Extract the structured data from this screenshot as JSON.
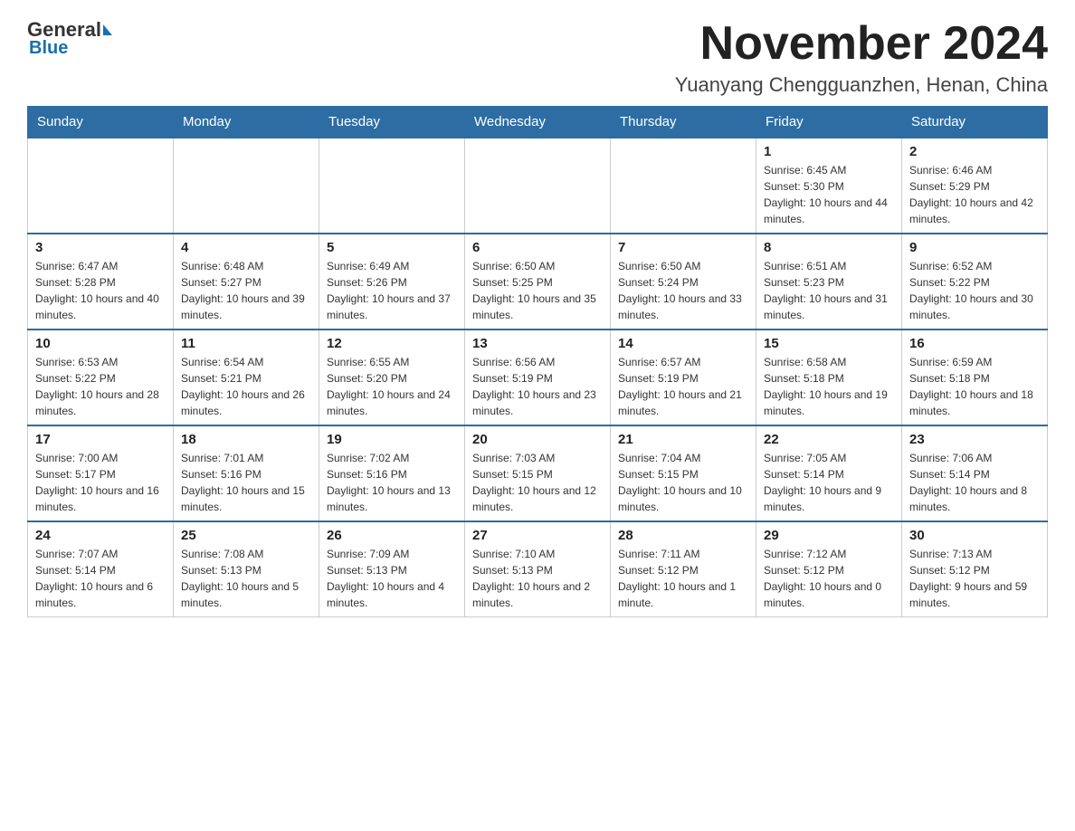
{
  "header": {
    "logo": {
      "general": "General",
      "blue": "Blue"
    },
    "title": "November 2024",
    "subtitle": "Yuanyang Chengguanzhen, Henan, China"
  },
  "weekdays": [
    "Sunday",
    "Monday",
    "Tuesday",
    "Wednesday",
    "Thursday",
    "Friday",
    "Saturday"
  ],
  "weeks": [
    [
      {
        "day": "",
        "info": ""
      },
      {
        "day": "",
        "info": ""
      },
      {
        "day": "",
        "info": ""
      },
      {
        "day": "",
        "info": ""
      },
      {
        "day": "",
        "info": ""
      },
      {
        "day": "1",
        "info": "Sunrise: 6:45 AM\nSunset: 5:30 PM\nDaylight: 10 hours and 44 minutes."
      },
      {
        "day": "2",
        "info": "Sunrise: 6:46 AM\nSunset: 5:29 PM\nDaylight: 10 hours and 42 minutes."
      }
    ],
    [
      {
        "day": "3",
        "info": "Sunrise: 6:47 AM\nSunset: 5:28 PM\nDaylight: 10 hours and 40 minutes."
      },
      {
        "day": "4",
        "info": "Sunrise: 6:48 AM\nSunset: 5:27 PM\nDaylight: 10 hours and 39 minutes."
      },
      {
        "day": "5",
        "info": "Sunrise: 6:49 AM\nSunset: 5:26 PM\nDaylight: 10 hours and 37 minutes."
      },
      {
        "day": "6",
        "info": "Sunrise: 6:50 AM\nSunset: 5:25 PM\nDaylight: 10 hours and 35 minutes."
      },
      {
        "day": "7",
        "info": "Sunrise: 6:50 AM\nSunset: 5:24 PM\nDaylight: 10 hours and 33 minutes."
      },
      {
        "day": "8",
        "info": "Sunrise: 6:51 AM\nSunset: 5:23 PM\nDaylight: 10 hours and 31 minutes."
      },
      {
        "day": "9",
        "info": "Sunrise: 6:52 AM\nSunset: 5:22 PM\nDaylight: 10 hours and 30 minutes."
      }
    ],
    [
      {
        "day": "10",
        "info": "Sunrise: 6:53 AM\nSunset: 5:22 PM\nDaylight: 10 hours and 28 minutes."
      },
      {
        "day": "11",
        "info": "Sunrise: 6:54 AM\nSunset: 5:21 PM\nDaylight: 10 hours and 26 minutes."
      },
      {
        "day": "12",
        "info": "Sunrise: 6:55 AM\nSunset: 5:20 PM\nDaylight: 10 hours and 24 minutes."
      },
      {
        "day": "13",
        "info": "Sunrise: 6:56 AM\nSunset: 5:19 PM\nDaylight: 10 hours and 23 minutes."
      },
      {
        "day": "14",
        "info": "Sunrise: 6:57 AM\nSunset: 5:19 PM\nDaylight: 10 hours and 21 minutes."
      },
      {
        "day": "15",
        "info": "Sunrise: 6:58 AM\nSunset: 5:18 PM\nDaylight: 10 hours and 19 minutes."
      },
      {
        "day": "16",
        "info": "Sunrise: 6:59 AM\nSunset: 5:18 PM\nDaylight: 10 hours and 18 minutes."
      }
    ],
    [
      {
        "day": "17",
        "info": "Sunrise: 7:00 AM\nSunset: 5:17 PM\nDaylight: 10 hours and 16 minutes."
      },
      {
        "day": "18",
        "info": "Sunrise: 7:01 AM\nSunset: 5:16 PM\nDaylight: 10 hours and 15 minutes."
      },
      {
        "day": "19",
        "info": "Sunrise: 7:02 AM\nSunset: 5:16 PM\nDaylight: 10 hours and 13 minutes."
      },
      {
        "day": "20",
        "info": "Sunrise: 7:03 AM\nSunset: 5:15 PM\nDaylight: 10 hours and 12 minutes."
      },
      {
        "day": "21",
        "info": "Sunrise: 7:04 AM\nSunset: 5:15 PM\nDaylight: 10 hours and 10 minutes."
      },
      {
        "day": "22",
        "info": "Sunrise: 7:05 AM\nSunset: 5:14 PM\nDaylight: 10 hours and 9 minutes."
      },
      {
        "day": "23",
        "info": "Sunrise: 7:06 AM\nSunset: 5:14 PM\nDaylight: 10 hours and 8 minutes."
      }
    ],
    [
      {
        "day": "24",
        "info": "Sunrise: 7:07 AM\nSunset: 5:14 PM\nDaylight: 10 hours and 6 minutes."
      },
      {
        "day": "25",
        "info": "Sunrise: 7:08 AM\nSunset: 5:13 PM\nDaylight: 10 hours and 5 minutes."
      },
      {
        "day": "26",
        "info": "Sunrise: 7:09 AM\nSunset: 5:13 PM\nDaylight: 10 hours and 4 minutes."
      },
      {
        "day": "27",
        "info": "Sunrise: 7:10 AM\nSunset: 5:13 PM\nDaylight: 10 hours and 2 minutes."
      },
      {
        "day": "28",
        "info": "Sunrise: 7:11 AM\nSunset: 5:12 PM\nDaylight: 10 hours and 1 minute."
      },
      {
        "day": "29",
        "info": "Sunrise: 7:12 AM\nSunset: 5:12 PM\nDaylight: 10 hours and 0 minutes."
      },
      {
        "day": "30",
        "info": "Sunrise: 7:13 AM\nSunset: 5:12 PM\nDaylight: 9 hours and 59 minutes."
      }
    ]
  ]
}
